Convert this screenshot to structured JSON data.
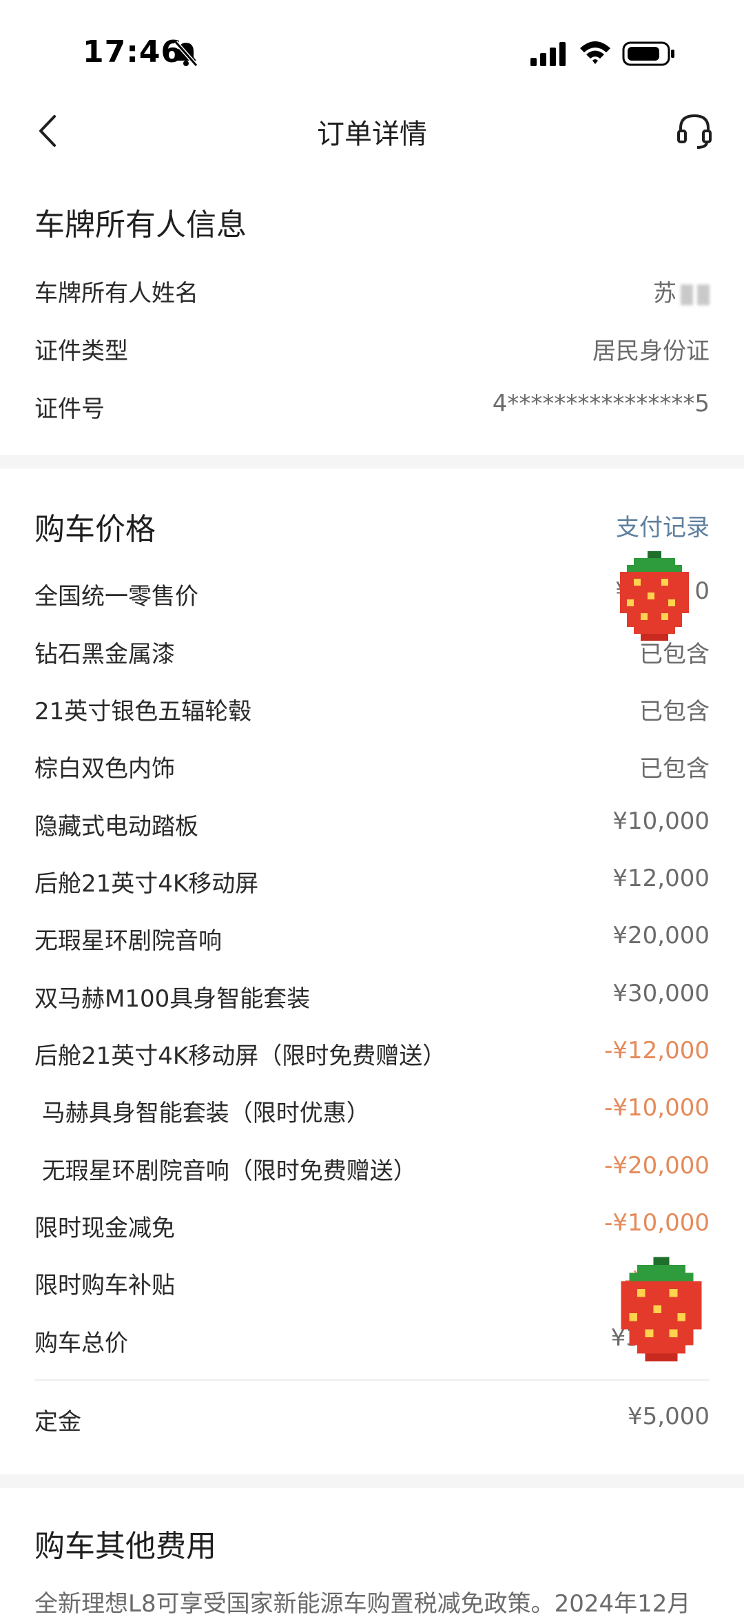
{
  "status_bar": {
    "time": "17:46",
    "icons": [
      "bell-slash-icon",
      "signal-icon",
      "wifi-icon",
      "battery-icon"
    ]
  },
  "nav": {
    "title": "订单详情",
    "back_icon": "chevron-left-icon",
    "service_icon": "headset-icon"
  },
  "owner_section": {
    "title": "车牌所有人信息",
    "rows": [
      {
        "label": "车牌所有人姓名",
        "value": "苏"
      },
      {
        "label": "证件类型",
        "value": "居民身份证"
      },
      {
        "label": "证件号",
        "value": "4****************5"
      }
    ]
  },
  "price_section": {
    "title": "购车价格",
    "link": "支付记录",
    "rows": [
      {
        "label": "全国统一零售价",
        "value": "¥3",
        "value_tail": "0"
      },
      {
        "label": "钻石黑金属漆",
        "value": "已包含"
      },
      {
        "label": "21英寸银色五辐轮毂",
        "value": "已包含"
      },
      {
        "label": "棕白双色内饰",
        "value": "已包含"
      },
      {
        "label": "隐藏式电动踏板",
        "value": "¥10,000"
      },
      {
        "label": "后舱21英寸4K移动屏",
        "value": "¥12,000"
      },
      {
        "label": "无瑕星环剧院音响",
        "value": "¥20,000"
      },
      {
        "label": "双马赫M100具身智能套装",
        "value": "¥30,000"
      },
      {
        "label": "后舱21英寸4K移动屏（限时免费赠送）",
        "value": "-¥12,000"
      },
      {
        "label": " 马赫具身智能套装（限时优惠）",
        "value": "-¥10,000"
      },
      {
        "label": " 无瑕星环剧院音响（限时免费赠送）",
        "value": "-¥20,000"
      },
      {
        "label": "限时现金减免",
        "value": "-¥10,000"
      },
      {
        "label": "限时购车补贴",
        "value": "-¥"
      },
      {
        "label": "购车总价",
        "value": "¥3"
      }
    ],
    "deposit": {
      "label": "定金",
      "value": "¥5,000"
    }
  },
  "other_section": {
    "title": "购车其他费用",
    "note": "全新理想L8可享受国家新能源车购置税减免政策。2024年12月"
  },
  "colors": {
    "link": "#5d7f9e",
    "discount": "#e58a5a",
    "gap": "#f5f5f5"
  }
}
